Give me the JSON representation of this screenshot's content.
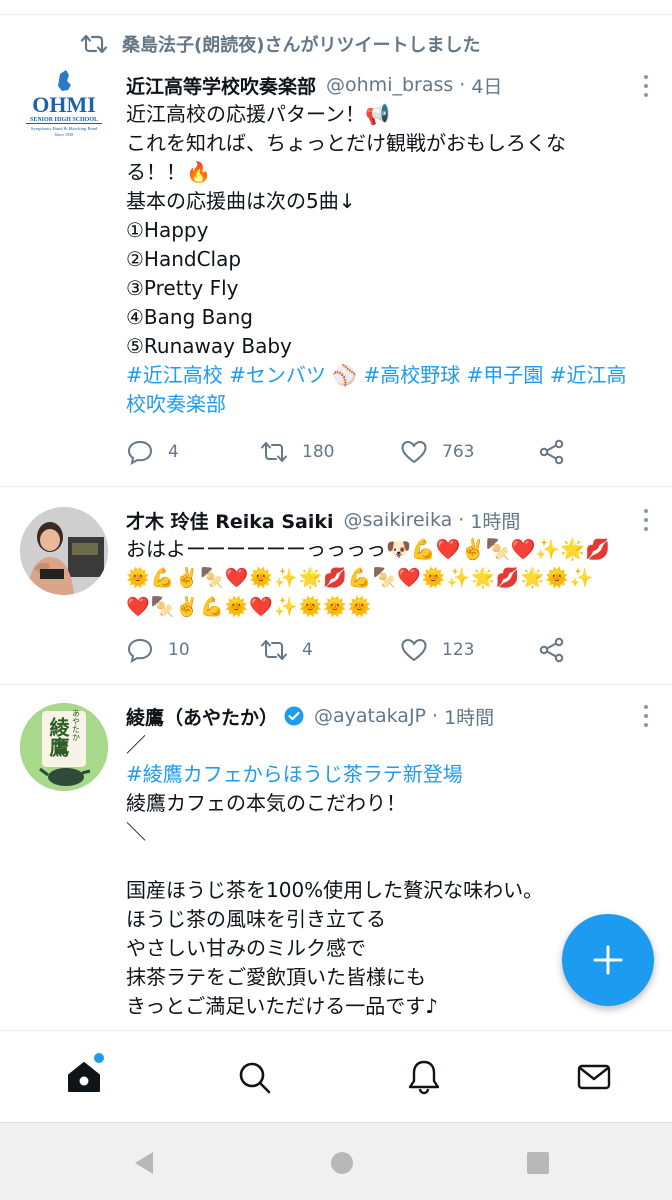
{
  "retweet_banner": {
    "text": "桑島法子(朗読夜)さんがリツイートしました"
  },
  "tweets": [
    {
      "name": "近江高等学校吹奏楽部",
      "handle": "@ohmi_brass",
      "dot": "·",
      "time": "4日",
      "avatar_logo": {
        "title": "OHMI",
        "subtitle": "SENIOR HIGH SCHOOL",
        "tagline": "Symphonic Band & Marching Band",
        "since": "Since 1938"
      },
      "lines": [
        "近江高校の応援パターン！📢",
        "これを知れば、ちょっとだけ観戦がおもしろくな",
        "る！！🔥",
        "基本の応援曲は次の5曲↓",
        "①Happy",
        "②HandClap",
        "③Pretty Fly",
        "④Bang Bang",
        "⑤Runaway Baby"
      ],
      "hashtag_lines": [
        "#近江高校 #センバツ ⚾ #高校野球 #甲子園 #近江高",
        "校吹奏楽部"
      ],
      "replies": "4",
      "retweets": "180",
      "likes": "763"
    },
    {
      "name": "才木 玲佳 Reika Saiki",
      "handle": "@saikireika",
      "dot": "·",
      "time": "1時間",
      "lines": [
        "おはよーーーーーーっっっっ🐶💪❤️✌️🍢❤️✨🌟💋",
        "🌞💪✌️🍢❤️🌞✨🌟💋💪🍢❤️🌞✨🌟💋🌟🌞✨",
        "❤️🍢✌️💪🌞❤️✨🌞🌞🌞"
      ],
      "replies": "10",
      "retweets": "4",
      "likes": "123"
    },
    {
      "name": "綾鷹（あやたか）",
      "handle": "@ayatakaJP",
      "dot": "·",
      "time": "1時間",
      "avatar_text": {
        "kanji": "綾鷹",
        "kana": "あやたか"
      },
      "lines": [
        "／",
        "#綾鷹カフェからほうじ茶ラテ新登場",
        "綾鷹カフェの本気のこだわり！",
        "＼",
        "",
        "国産ほうじ茶を100%使用した贅沢な味わい。",
        "ほうじ茶の風味を引き立てる",
        "やさしい甘みのミルク感で",
        "抹茶ラテをご愛飲頂いた皆様にも",
        "きっとご満足いただける一品です♪"
      ]
    }
  ],
  "icons": {
    "retweet": "retweet-icon",
    "reply": "reply-icon",
    "like": "heart-icon",
    "share": "share-icon",
    "verified": "verified-badge-icon",
    "compose": "plus-icon",
    "home": "home-icon",
    "search": "search-icon",
    "notifications": "bell-icon",
    "messages": "envelope-icon"
  },
  "colors": {
    "accent": "#1d9bf0",
    "muted": "#657786",
    "divider": "#e6ecf0",
    "text": "#0f1419"
  }
}
